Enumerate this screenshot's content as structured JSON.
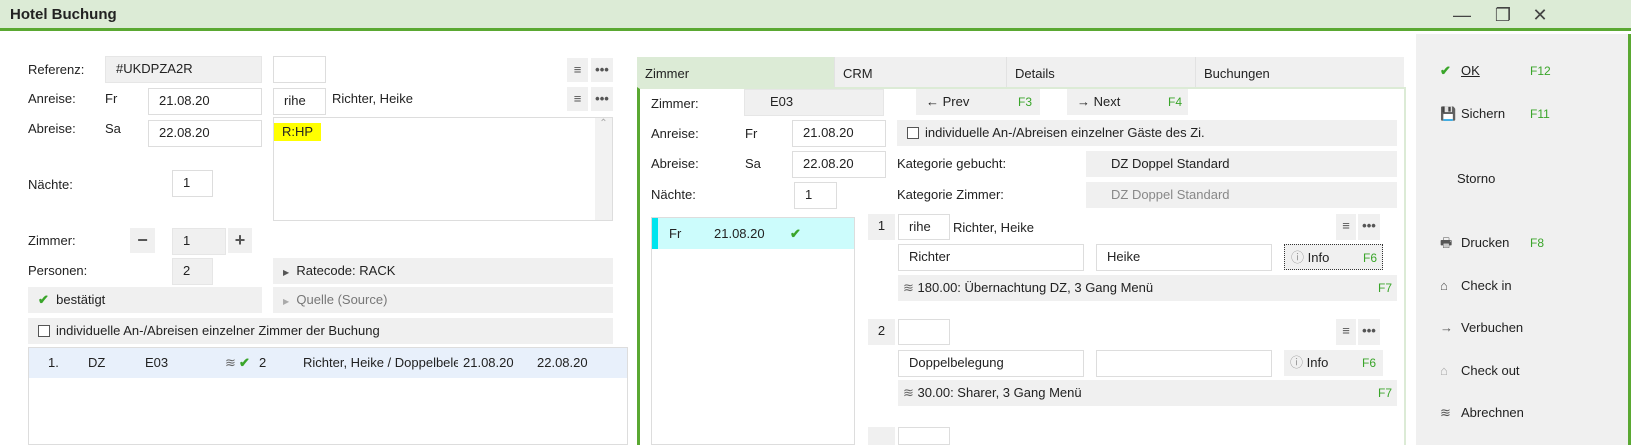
{
  "window": {
    "title": "Hotel Buchung",
    "minimize": "—",
    "restore": "❐",
    "close": "✕"
  },
  "left": {
    "referenz_label": "Referenz:",
    "referenz": "#UKDPZA2R",
    "anreise_label": "Anreise:",
    "anreise_day": "Fr",
    "anreise_date": "21.08.20",
    "abreise_label": "Abreise:",
    "abreise_day": "Sa",
    "abreise_date": "22.08.20",
    "guest_code": "rihe",
    "guest_name": "Richter, Heike",
    "note": "R:HP",
    "naechte_label": "Nächte:",
    "naechte": "1",
    "zimmer_label": "Zimmer:",
    "zimmer": "1",
    "personen_label": "Personen:",
    "personen": "2",
    "ratecode": "Ratecode: RACK",
    "quelle": "Quelle (Source)",
    "status": "bestätigt",
    "individual_checkbox": "individuelle An-/Abreisen einzelner Zimmer der Buchung",
    "rows": [
      {
        "nr": "1.",
        "cat": "DZ",
        "room": "E03",
        "persons": "2",
        "name": "Richter, Heike / Doppelbelegung",
        "from": "21.08.20",
        "to": "22.08.20"
      }
    ]
  },
  "tabs": [
    "Zimmer",
    "CRM",
    "Details",
    "Buchungen"
  ],
  "room": {
    "zimmer_label": "Zimmer:",
    "zimmer": "E03",
    "prev": "Prev",
    "prev_key": "F3",
    "next": "Next",
    "next_key": "F4",
    "anreise_label": "Anreise:",
    "anreise_day": "Fr",
    "anreise_date": "21.08.20",
    "abreise_label": "Abreise:",
    "abreise_day": "Sa",
    "abreise_date": "22.08.20",
    "naechte_label": "Nächte:",
    "naechte": "1",
    "individual_checkbox": "individuelle An-/Abreisen einzelner Gäste des Zi.",
    "kat_gebucht_label": "Kategorie gebucht:",
    "kat_gebucht": "DZ Doppel Standard",
    "kat_zimmer_label": "Kategorie Zimmer:",
    "kat_zimmer": "DZ Doppel Standard",
    "days": [
      {
        "day": "Fr",
        "date": "21.08.20"
      }
    ],
    "guests": [
      {
        "nr": "1",
        "code": "rihe",
        "display": "Richter, Heike",
        "last": "Richter",
        "first": "Heike",
        "info": "Info",
        "info_key": "F6",
        "rate": "180.00: Übernachtung DZ, 3 Gang Menü",
        "rate_key": "F7"
      },
      {
        "nr": "2",
        "code": "",
        "display": "",
        "last": "Doppelbelegung",
        "first": "",
        "info": "Info",
        "info_key": "F6",
        "rate": "30.00: Sharer, 3 Gang Menü",
        "rate_key": "F7"
      }
    ]
  },
  "sidebar": [
    {
      "label": "OK",
      "key": "F12",
      "icon": "✔"
    },
    {
      "label": "Sichern",
      "key": "F11",
      "icon": "💾"
    },
    {
      "label": "Storno",
      "key": "",
      "icon": ""
    },
    {
      "label": "Drucken",
      "key": "F8",
      "icon": "🖶"
    },
    {
      "label": "Check in",
      "key": "",
      "icon": "⌂"
    },
    {
      "label": "Verbuchen",
      "key": "",
      "icon": "→"
    },
    {
      "label": "Check out",
      "key": "",
      "icon": "⌂"
    },
    {
      "label": "Abrechnen",
      "key": "",
      "icon": "≋"
    }
  ],
  "colors": {
    "accent": "#5aa832",
    "title_bg": "#dcebd6",
    "day_row": "#ccfcfc",
    "fkey": "#3aa52a"
  }
}
